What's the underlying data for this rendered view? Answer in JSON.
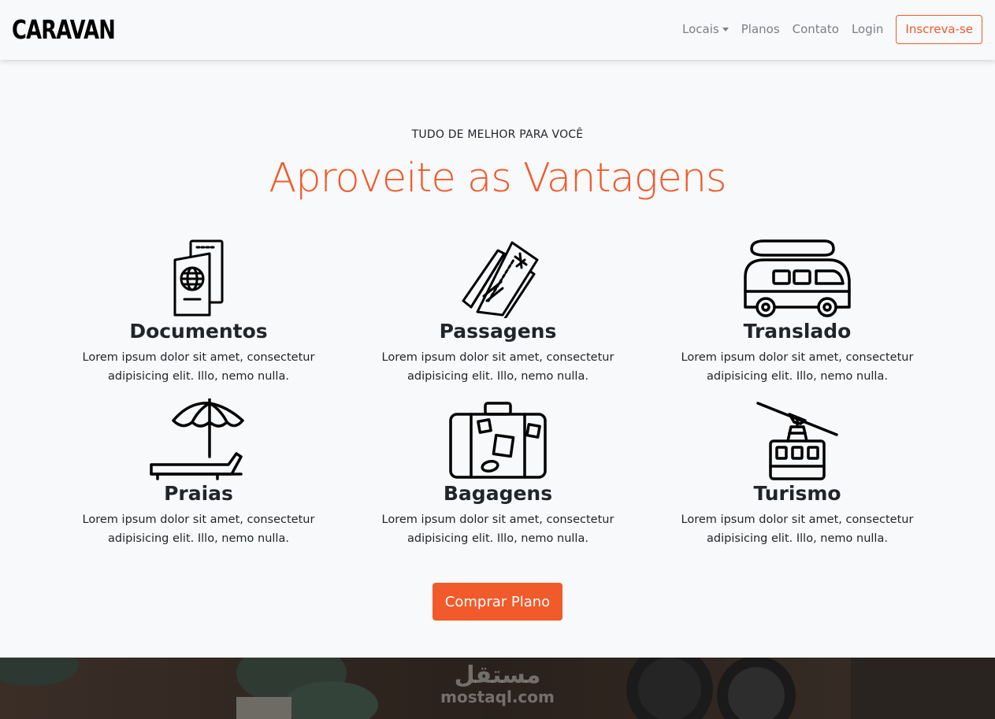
{
  "navbar": {
    "brand": "CARAVAN",
    "links": [
      {
        "label": "Locais",
        "dropdown": true
      },
      {
        "label": "Planos"
      },
      {
        "label": "Contato"
      },
      {
        "label": "Login"
      }
    ],
    "signup_label": "Inscreva-se"
  },
  "hero": {
    "eyebrow": "TUDO DE MELHOR PARA VOCÊ",
    "headline": "Aproveite as Vantagens"
  },
  "features": [
    {
      "title": "Documentos",
      "text": "Lorem ipsum dolor sit amet, consectetur adipisicing elit. Illo, nemo nulla.",
      "icon": "passport-icon"
    },
    {
      "title": "Passagens",
      "text": "Lorem ipsum dolor sit amet, consectetur adipisicing elit. Illo, nemo nulla.",
      "icon": "ticket-icon"
    },
    {
      "title": "Translado",
      "text": "Lorem ipsum dolor sit amet, consectetur adipisicing elit. Illo, nemo nulla.",
      "icon": "van-icon"
    },
    {
      "title": "Praias",
      "text": "Lorem ipsum dolor sit amet, consectetur adipisicing elit. Illo, nemo nulla.",
      "icon": "beach-umbrella-icon"
    },
    {
      "title": "Bagagens",
      "text": "Lorem ipsum dolor sit amet, consectetur adipisicing elit. Illo, nemo nulla.",
      "icon": "suitcase-icon"
    },
    {
      "title": "Turismo",
      "text": "Lorem ipsum dolor sit amet, consectetur adipisicing elit. Illo, nemo nulla.",
      "icon": "cable-car-icon"
    }
  ],
  "cta_label": "Comprar Plano",
  "watermark": {
    "arabic": "مستقل",
    "latin": "mostaql.com"
  },
  "colors": {
    "accent": "#f15a2b",
    "background": "#f8f9fa",
    "text": "#212529",
    "nav_link": "#7b7f84"
  }
}
